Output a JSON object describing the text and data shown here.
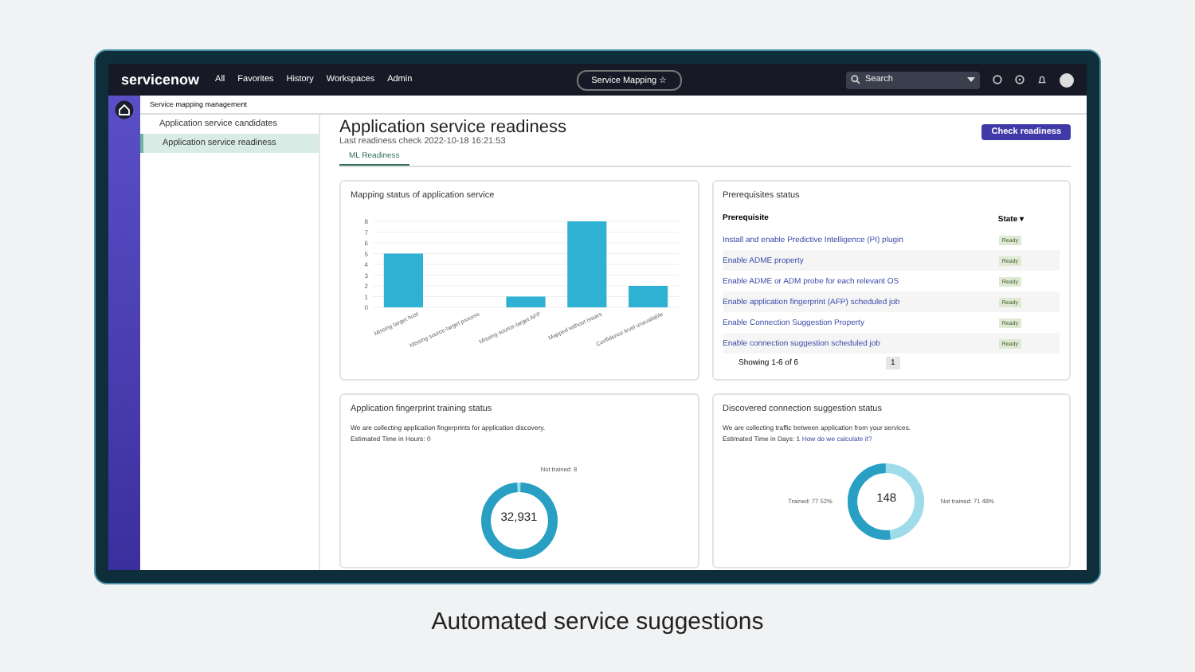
{
  "header": {
    "logo": "servicenow",
    "nav": [
      "All",
      "Favorites",
      "History",
      "Workspaces",
      "Admin"
    ],
    "context": "Service Mapping",
    "context_star": "☆",
    "search": {
      "placeholder": "Search"
    }
  },
  "breadcrumb": "Service mapping management",
  "sidebar": {
    "items": [
      {
        "label": "Application service candidates",
        "selected": false
      },
      {
        "label": "Application service readiness",
        "selected": true
      }
    ]
  },
  "page": {
    "title": "Application service readiness",
    "subtitle": "Last readiness check 2022-10-18 16:21:53",
    "action": "Check readiness",
    "tabs": [
      {
        "label": "ML Readiness",
        "selected": true
      }
    ]
  },
  "mapping_card": {
    "title": "Mapping status of application service",
    "chart_data": {
      "type": "bar",
      "categories": [
        "Missing target host",
        "Missing source-target process",
        "Missing source-target AFP",
        "Mapped without issues",
        "Confidence level unavailable"
      ],
      "yticks": [
        0,
        1,
        2,
        3,
        4,
        5,
        6,
        7,
        8
      ],
      "ylim": [
        0,
        8
      ],
      "grid": true,
      "series": [
        {
          "color": "#2eb1d3",
          "values": [
            5,
            0,
            1,
            8,
            2
          ]
        }
      ]
    }
  },
  "prereq_card": {
    "title": "Prerequisites status",
    "columns": [
      "Prerequisite",
      "State"
    ],
    "sort_mark": "▾",
    "rows": [
      {
        "name": "Install and enable Predictive Intelligence (PI) plugin",
        "state": "Ready"
      },
      {
        "name": "Enable ADME property",
        "state": "Ready"
      },
      {
        "name": "Enable ADME or ADM probe for each relevant OS",
        "state": "Ready"
      },
      {
        "name": "Enable application fingerprint (AFP) scheduled job",
        "state": "Ready"
      },
      {
        "name": "Enable Connection Suggestion Property",
        "state": "Ready"
      },
      {
        "name": "Enable connection suggestion scheduled job",
        "state": "Ready"
      }
    ],
    "showing": "Showing 1-6 of 6",
    "pages": [
      {
        "label": "1",
        "selected": true
      }
    ]
  },
  "fingerprint_card": {
    "title": "Application fingerprint training status",
    "lines": [
      "We are collecting application fingerprints for application discovery.",
      "Estimated Time in Hours: 0"
    ],
    "donut_value": "32,931",
    "legend": [
      "Not trained: 8"
    ],
    "level": 0.99
  },
  "connection_card": {
    "title": "Discovered connection suggestion status",
    "lines": [
      "We are collecting traffic between application from your services."
    ],
    "estimate": "Estimated Time in Days: 1",
    "link": "How do we calculate it?",
    "donut_value": "148",
    "legend_left": "Trained: 77  52%",
    "legend_right": "Not trained: 71  48%",
    "level": 0.52
  },
  "caption": "Automated service suggestions"
}
